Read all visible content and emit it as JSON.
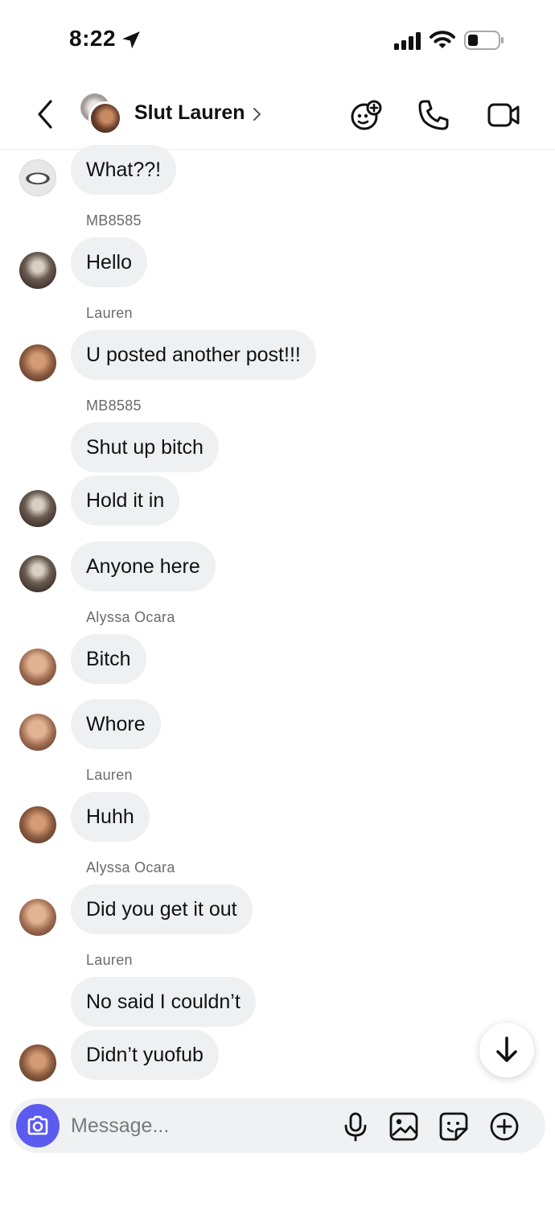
{
  "status_bar": {
    "time": "8:22"
  },
  "header": {
    "chat_title": "Slut Lauren"
  },
  "messages": [
    {
      "text": "What??!"
    },
    {
      "sender": "MB8585",
      "text": "Hello"
    },
    {
      "sender": "Lauren",
      "text": "U posted another post!!!"
    },
    {
      "sender": "MB8585",
      "text": "Shut up bitch"
    },
    {
      "text": "Hold it in"
    },
    {
      "text": "Anyone here"
    },
    {
      "sender": "Alyssa Ocara",
      "text": "Bitch"
    },
    {
      "text": "Whore"
    },
    {
      "sender": "Lauren",
      "text": "Huhh"
    },
    {
      "sender": "Alyssa Ocara",
      "text": "Did you get it out"
    },
    {
      "sender": "Lauren",
      "text": "No said I couldn’t"
    },
    {
      "text": "Didn’t yuofub"
    }
  ],
  "composer": {
    "placeholder": "Message..."
  },
  "colors": {
    "bubble": "#eff0f2",
    "camera_button": "#5b5bf0"
  },
  "icons": [
    "back-chevron-icon",
    "location-arrow-icon",
    "signal-icon",
    "wifi-icon",
    "battery-icon",
    "game-controller-icon",
    "phone-icon",
    "video-camera-icon",
    "arrow-down-icon",
    "camera-icon",
    "microphone-icon",
    "image-icon",
    "sticker-icon",
    "plus-circle-icon"
  ]
}
